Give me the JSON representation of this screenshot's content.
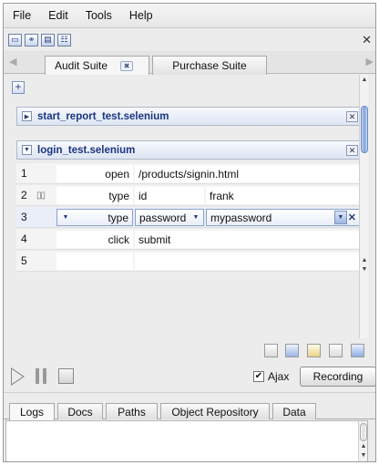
{
  "menu": [
    "File",
    "Edit",
    "Tools",
    "Help"
  ],
  "toolbar": {
    "buttons": [
      "new-suite-icon",
      "find-icon",
      "save-icon",
      "tree-view-icon"
    ],
    "close_glyph": "✕"
  },
  "suite_tabs": {
    "active": {
      "label": "Audit Suite",
      "close_glyph": "✖"
    },
    "inactive": {
      "label": "Purchase Suite"
    }
  },
  "editor": {
    "add_glyph": "+",
    "tests": [
      {
        "title": "start_report_test.selenium",
        "expanded": false,
        "expander": "▶",
        "close": "✕"
      },
      {
        "title": "login_test.selenium",
        "expanded": true,
        "expander": "▼",
        "close": "✕"
      }
    ],
    "rows": [
      {
        "num": "1",
        "command": "open",
        "target": "/products/signin.html",
        "value": ""
      },
      {
        "num": "2",
        "command": "type",
        "target": "id",
        "value": "frank"
      },
      {
        "num": "3",
        "command": "type",
        "target": "password",
        "value": "mypassword"
      },
      {
        "num": "4",
        "command": "click",
        "target": "submit",
        "value": ""
      },
      {
        "num": "5",
        "command": "",
        "target": "",
        "value": ""
      }
    ],
    "row2_grip": "▯▯",
    "row3_glyphs": {
      "dropdown": "▼",
      "remove": "✕"
    }
  },
  "icon_bar": [
    "export-icon",
    "import-icon",
    "folder-new-icon",
    "document-icon",
    "folder-icon"
  ],
  "run": {
    "ajax_label": "Ajax",
    "ajax_checked_glyph": "✔",
    "record_label": "Recording"
  },
  "bottom_tabs": [
    "Logs",
    "Docs",
    "Paths",
    "Object Repository",
    "Data"
  ],
  "colors": {
    "accent": "#1b3580",
    "scroll_thumb": "#7fa2d8"
  }
}
